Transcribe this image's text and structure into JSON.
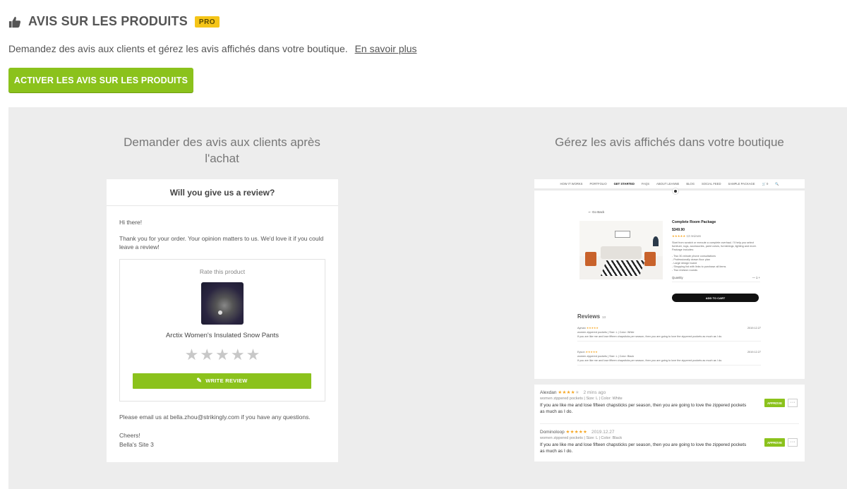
{
  "header": {
    "title": "AVIS SUR LES PRODUITS",
    "badge": "PRO",
    "icon": "thumbs-up-icon"
  },
  "description": {
    "text": "Demandez des avis aux clients et gérez les avis affichés dans votre boutique.",
    "link": "En savoir plus"
  },
  "activate_button": "ACTIVER LES AVIS SUR LES PRODUITS",
  "left_col": {
    "title": "Demander des avis aux clients après l'achat",
    "email": {
      "heading": "Will you give us a review?",
      "greeting": "Hi there!",
      "message": "Thank you for your order. Your opinion matters to us. We'd love it if you could leave a review!",
      "rate_label": "Rate this product",
      "product_name": "Arctix Women's Insulated Snow Pants",
      "stars": "★★★★★",
      "write_button": "WRITE REVIEW",
      "contact": "Please email us at bella.zhou@strikingly.com if you have any questions.",
      "signoff": "Cheers!",
      "site": "Bella's Site 3"
    }
  },
  "right_col": {
    "title": "Gérez les avis affichés dans votre boutique",
    "shop": {
      "nav": [
        "HOW IT WORKS",
        "PORTFOLIO",
        "GET STARTED",
        "FAQS",
        "ABOUT LEANNE",
        "BLOG",
        "SOCIAL FEED",
        "SAMPLE PACKAGE",
        "🛒 0",
        "🔍"
      ],
      "go_back": "⇠ Go Back",
      "product_title": "Complete Room Package",
      "price": "$349.90",
      "rating_stars": "★★★★★",
      "rating_count": "13 reviews",
      "desc": "Start from scratch or execute a complete overhaul. I'll help you select furniture, rugs, accessories, paint colors, furnishings, lighting and more. Package includes:",
      "list": [
        "- Two 30-minute phone consultations",
        "- Professionally drawn floor plan",
        "- Large design board",
        "- Shopping list with links to purchase all items",
        "- Two revision rounds"
      ],
      "qty_label": "Quantity",
      "qty_controls": "—     1     +",
      "add_to_cart": "ADD TO CART",
      "reviews_title": "Reviews",
      "reviews_count": "13",
      "mini_reviews": [
        {
          "name": "Ayman",
          "stars": "★★★★★",
          "date": "2019.12.27",
          "meta": "women zippered pockets  |  Size: L  |  Color: White",
          "text": "If you are like me and lose fifteen chapsticks per season, then you are going to love the zippered pockets as much as I do."
        },
        {
          "name": "Eyson",
          "stars": "★★★★★",
          "date": "2019.12.27",
          "meta": "women zippered pockets  |  Size: L  |  Color: Black",
          "text": "If you are like me and lose fifteen chapsticks per season, then you are going to love the zippered pockets as much as I do."
        }
      ]
    },
    "admin": [
      {
        "name": "Alexdan",
        "stars": "★★★★",
        "empty_star": "★",
        "time": "2 mins ago",
        "meta": "women zippered pockets  |  Size: L  |  Color: White",
        "text": "If you are like me and lose fifteen chapsticks per season, then you are going to love the zippered pockets as much as I do.",
        "approve": "APPROVE",
        "more": "···"
      },
      {
        "name": "Dominoloop",
        "stars": "★★★★★",
        "empty_star": "",
        "time": "2019.12.27",
        "meta": "women zippered pockets  |  Size: L  |  Color: Black",
        "text": "If you are like me and lose fifteen chapsticks per season, then you are going to love the zippered pockets as much as I do.",
        "approve": "APPROVE",
        "more": "···"
      }
    ]
  },
  "colors": {
    "accent_green": "#8bc21c",
    "pro_badge": "#f5c518",
    "panel_bg": "#ededed",
    "star": "#f5a623"
  }
}
